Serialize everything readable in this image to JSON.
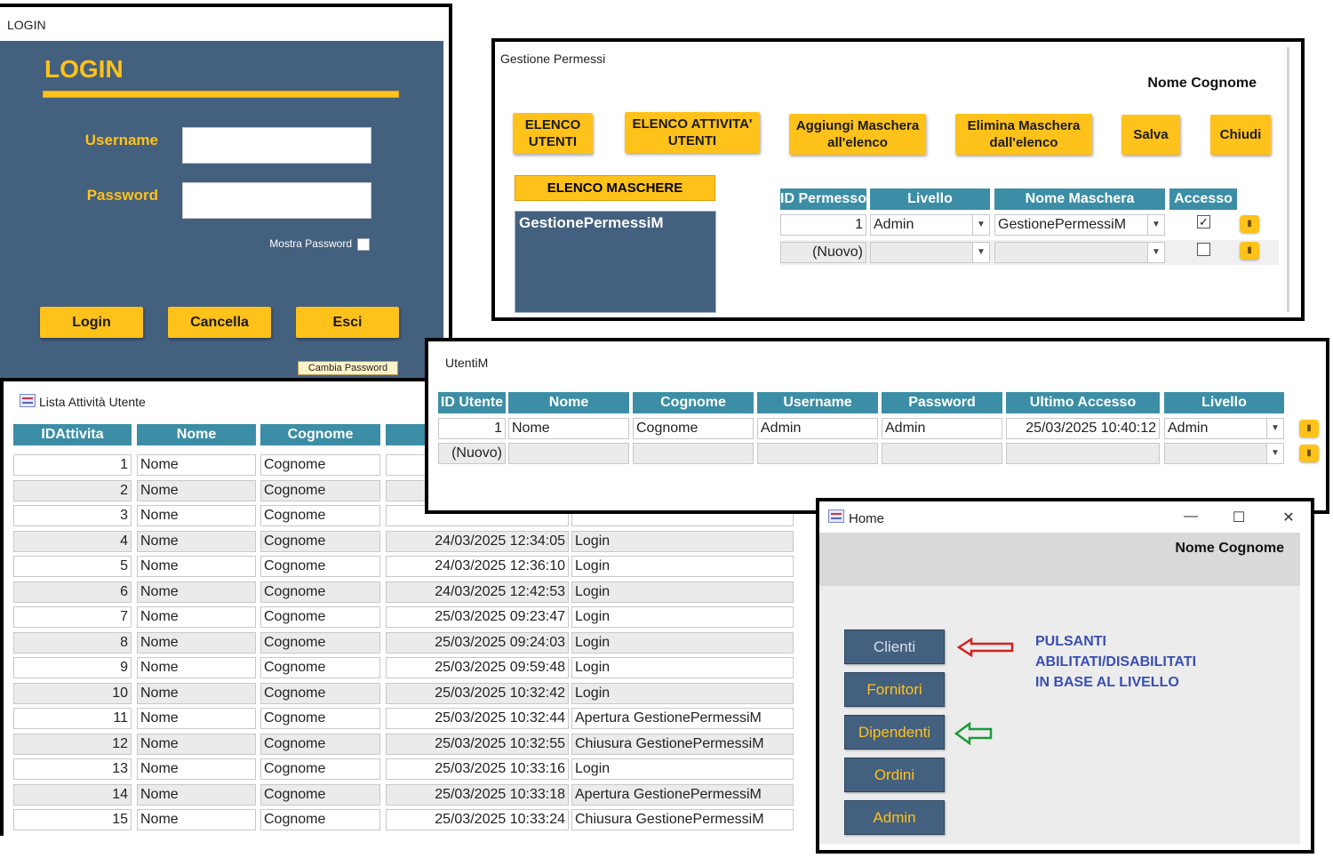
{
  "login": {
    "window_title": "LOGIN",
    "heading": "LOGIN",
    "username_label": "Username",
    "username_value": "",
    "password_label": "Password",
    "password_value": "",
    "show_password_label": "Mostra Password",
    "show_password_checked": false,
    "buttons": {
      "login": "Login",
      "cancel": "Cancella",
      "exit": "Esci"
    },
    "change_password": "Cambia Password"
  },
  "permessi": {
    "window_title": "Gestione Permessi",
    "user_name": "Nome Cognome",
    "buttons": {
      "elenco_utenti_1": "ELENCO",
      "elenco_utenti_2": "UTENTI",
      "elenco_attivita_1": "ELENCO ATTIVITA'",
      "elenco_attivita_2": "UTENTI",
      "aggiungi_1": "Aggiungi Maschera",
      "aggiungi_2": "all'elenco",
      "elimina_1": "Elimina Maschera",
      "elimina_2": "dall'elenco",
      "salva": "Salva",
      "chiudi": "Chiudi"
    },
    "maschere_header": "ELENCO MASCHERE",
    "maschere_items": [
      "GestionePermessiM"
    ],
    "columns": [
      "ID Permesso",
      "Livello",
      "Nome Maschera",
      "Accesso"
    ],
    "rows": [
      {
        "id": "1",
        "livello": "Admin",
        "maschera": "GestionePermessiM",
        "accesso": "✓"
      },
      {
        "id": "(Nuovo)",
        "livello": "",
        "maschera": "",
        "accesso": ""
      }
    ]
  },
  "lista": {
    "window_title": "Lista Attività Utente",
    "columns": [
      "IDAttivita",
      "Nome",
      "Cognome"
    ],
    "rows": [
      {
        "id": "1",
        "nome": "Nome",
        "cognome": "Cognome",
        "data": "",
        "azione": ""
      },
      {
        "id": "2",
        "nome": "Nome",
        "cognome": "Cognome",
        "data": "",
        "azione": ""
      },
      {
        "id": "3",
        "nome": "Nome",
        "cognome": "Cognome",
        "data": "",
        "azione": ""
      },
      {
        "id": "4",
        "nome": "Nome",
        "cognome": "Cognome",
        "data": "24/03/2025 12:34:05",
        "azione": "Login"
      },
      {
        "id": "5",
        "nome": "Nome",
        "cognome": "Cognome",
        "data": "24/03/2025 12:36:10",
        "azione": "Login"
      },
      {
        "id": "6",
        "nome": "Nome",
        "cognome": "Cognome",
        "data": "24/03/2025 12:42:53",
        "azione": "Login"
      },
      {
        "id": "7",
        "nome": "Nome",
        "cognome": "Cognome",
        "data": "25/03/2025 09:23:47",
        "azione": "Login"
      },
      {
        "id": "8",
        "nome": "Nome",
        "cognome": "Cognome",
        "data": "25/03/2025 09:24:03",
        "azione": "Login"
      },
      {
        "id": "9",
        "nome": "Nome",
        "cognome": "Cognome",
        "data": "25/03/2025 09:59:48",
        "azione": "Login"
      },
      {
        "id": "10",
        "nome": "Nome",
        "cognome": "Cognome",
        "data": "25/03/2025 10:32:42",
        "azione": "Login"
      },
      {
        "id": "11",
        "nome": "Nome",
        "cognome": "Cognome",
        "data": "25/03/2025 10:32:44",
        "azione": "Apertura GestionePermessiM"
      },
      {
        "id": "12",
        "nome": "Nome",
        "cognome": "Cognome",
        "data": "25/03/2025 10:32:55",
        "azione": "Chiusura GestionePermessiM"
      },
      {
        "id": "13",
        "nome": "Nome",
        "cognome": "Cognome",
        "data": "25/03/2025 10:33:16",
        "azione": "Login"
      },
      {
        "id": "14",
        "nome": "Nome",
        "cognome": "Cognome",
        "data": "25/03/2025 10:33:18",
        "azione": "Apertura GestionePermessiM"
      },
      {
        "id": "15",
        "nome": "Nome",
        "cognome": "Cognome",
        "data": "25/03/2025 10:33:24",
        "azione": "Chiusura GestionePermessiM"
      }
    ]
  },
  "utenti": {
    "window_title": "UtentiM",
    "columns": [
      "ID Utente",
      "Nome",
      "Cognome",
      "Username",
      "Password",
      "Ultimo Accesso",
      "Livello"
    ],
    "rows": [
      {
        "id": "1",
        "nome": "Nome",
        "cognome": "Cognome",
        "username": "Admin",
        "password": "Admin",
        "ultimo": "25/03/2025 10:40:12",
        "livello": "Admin"
      },
      {
        "id": "(Nuovo)",
        "nome": "",
        "cognome": "",
        "username": "",
        "password": "",
        "ultimo": "",
        "livello": ""
      }
    ]
  },
  "home": {
    "window_title": "Home",
    "user_name": "Nome Cognome",
    "buttons": [
      "Clienti",
      "Fornitori",
      "Dipendenti",
      "Ordini",
      "Admin"
    ],
    "note_lines": [
      "PULSANTI",
      "ABILITATI/DISABILITATI",
      "IN BASE AL LIVELLO"
    ],
    "window_controls": {
      "minimize": "—",
      "maximize": "☐",
      "close": "✕"
    }
  },
  "colors": {
    "accent_yellow": "#ffc21a",
    "panel_blue": "#44607f",
    "header_teal": "#3b8ea5",
    "note_blue": "#3a4fb0",
    "arrow_red": "#d42020",
    "arrow_green": "#1c9a3a"
  }
}
